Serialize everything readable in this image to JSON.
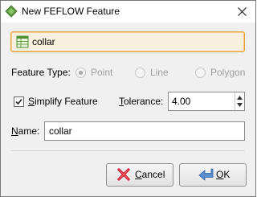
{
  "window": {
    "title": "New FEFLOW Feature"
  },
  "feature_select": {
    "value": "collar"
  },
  "feature_type": {
    "label_prefix": "Feature Type:",
    "options": [
      {
        "label": "Point",
        "selected": true,
        "enabled": false
      },
      {
        "label": "Line",
        "selected": false,
        "enabled": false
      },
      {
        "label": "Polygon",
        "selected": false,
        "enabled": false
      }
    ]
  },
  "simplify": {
    "label_mn": "S",
    "label_rest": "implify Feature",
    "checked": true
  },
  "tolerance": {
    "label_mn": "T",
    "label_rest": "olerance:",
    "value": "4.00"
  },
  "name": {
    "label_mn": "N",
    "label_rest": "ame:",
    "value": "collar"
  },
  "buttons": {
    "cancel": {
      "mn": "C",
      "rest": "ancel"
    },
    "ok": {
      "mn": "O",
      "rest": "K"
    }
  },
  "colors": {
    "accent_border": "#e4a24a",
    "select_bg": "#f8f0df",
    "disabled_text": "#a0a0a0"
  }
}
